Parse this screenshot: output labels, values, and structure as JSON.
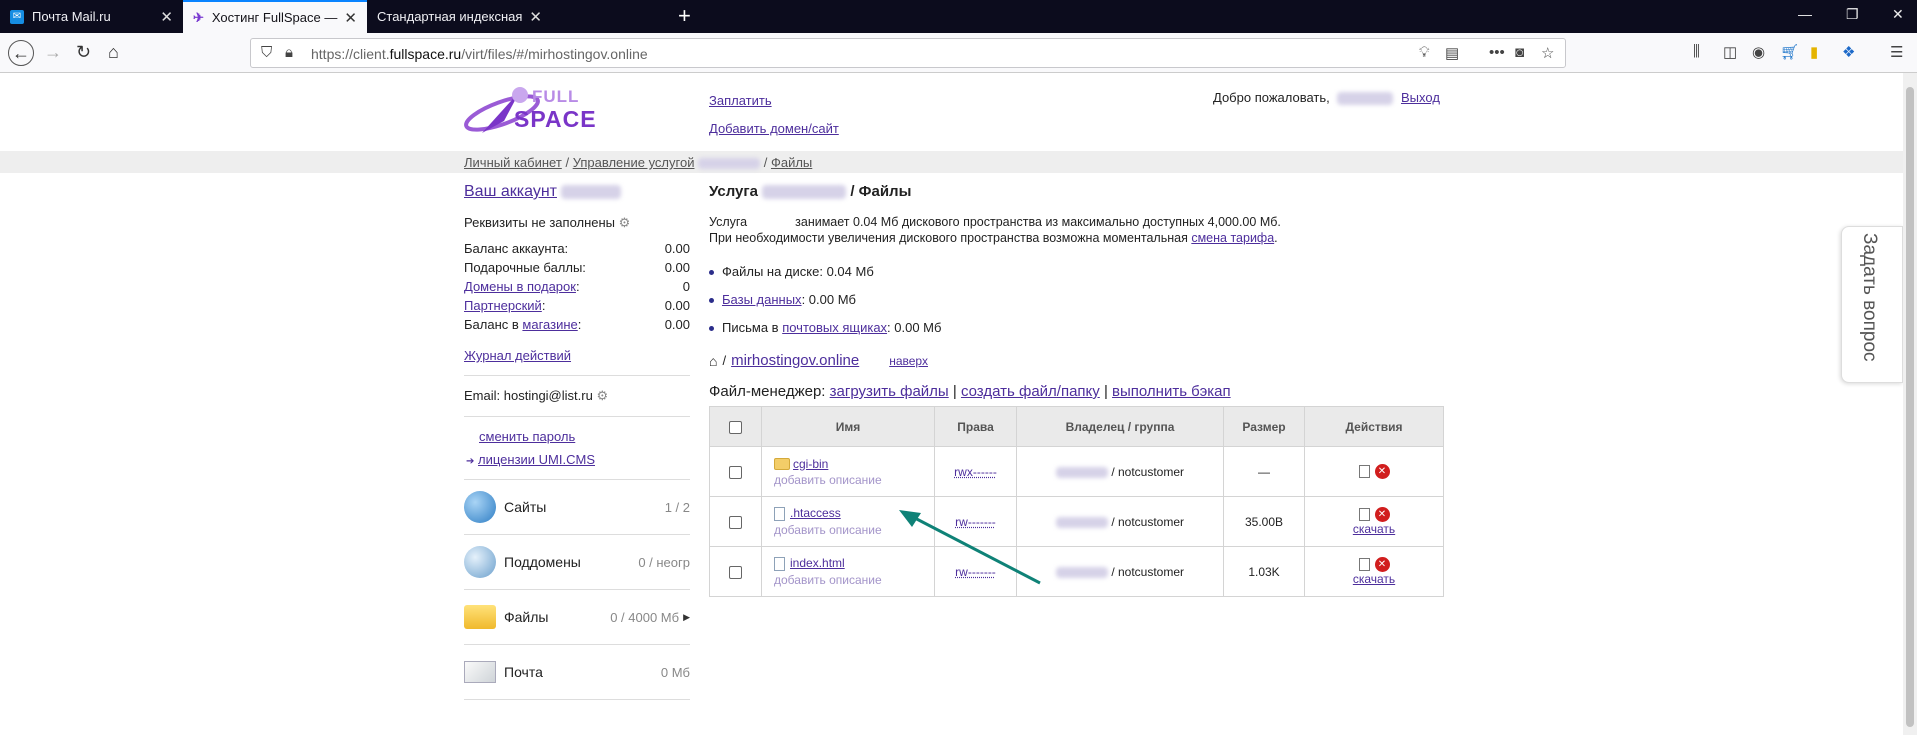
{
  "tabs": [
    {
      "title": "Почта Mail.ru",
      "icon": "mail-icon"
    },
    {
      "title": "Хостинг FullSpace — Личный",
      "icon": "fullspace-icon"
    },
    {
      "title": "Стандартная индексная страница",
      "icon": ""
    }
  ],
  "browser": {
    "url_prefix": "https://client.",
    "url_domain": "fullspace.ru",
    "url_path": "/virt/files/#/mirhostingov.online"
  },
  "logo": {
    "line1": "FULL",
    "line2": "SPACE"
  },
  "header": {
    "pay": "Заплатить",
    "add_domain": "Добавить домен/сайт",
    "welcome": "Добро пожаловать,",
    "logout": "Выход"
  },
  "breadcrumbs": {
    "cabinet": "Личный кабинет",
    "sep": "/",
    "services": "Управление услугой",
    "files": "Файлы"
  },
  "account": {
    "title": "Ваш аккаунт",
    "requisites": "Реквизиты не заполнены",
    "rows": [
      {
        "label": "Баланс аккаунта:",
        "value": "0.00"
      },
      {
        "label": "Подарочные баллы:",
        "value": "0.00"
      },
      {
        "label": "Домены в подарок",
        "suffix": ":",
        "value": "0"
      },
      {
        "label": "Партнерский",
        "suffix": ":",
        "value": "0.00"
      },
      {
        "label": "Баланс в",
        "link": "магазине",
        "suffix": ":",
        "value": "0.00"
      }
    ],
    "journal": "Журнал действий",
    "email_label": "Email:",
    "email": "hostingi@list.ru",
    "change_password": "сменить пароль",
    "umi": "лицензии UMI.CMS"
  },
  "services": [
    {
      "name": "Сайты",
      "count": "1 / 2",
      "icon": "globe-icon"
    },
    {
      "name": "Поддомены",
      "count": "0 / неогр",
      "icon": "subdomain-globe-icon"
    },
    {
      "name": "Файлы",
      "count": "0 / 4000 Мб",
      "icon": "folder-icon"
    },
    {
      "name": "Почта",
      "count": "0 Мб",
      "icon": "envelope-icon"
    }
  ],
  "main": {
    "title_prefix": "Услуга",
    "title_suffix": "/ Файлы",
    "usage_prefix": "Услуга",
    "usage_text": "занимает 0.04 Мб дискового пространства из максимально доступных 4,000.00 Мб.",
    "increase_text": "При необходимости увеличения дискового пространства возможна моментальная",
    "tariff_link": "смена тарифа",
    "period": ".",
    "stats": [
      {
        "pre": "Файлы на диске: 0.04 Мб",
        "link": "",
        "post": ""
      },
      {
        "pre": "",
        "link": "Базы данных",
        "post": ": 0.00 Мб"
      },
      {
        "pre": "Письма в ",
        "link": "почтовых ящиках",
        "post": ": 0.00 Мб"
      }
    ],
    "path_sep": "/",
    "path_domain": "mirhostingov.online",
    "up_link": "наверх",
    "fm_label": "Файл-менеджер:",
    "fm_upload": "загрузить файлы",
    "fm_sep": "|",
    "fm_create": "создать файл/папку",
    "fm_backup": "выполнить бэкап"
  },
  "table": {
    "headers": {
      "name": "Имя",
      "perms": "Права",
      "owner": "Владелец / группа",
      "size": "Размер",
      "actions": "Действия"
    },
    "rows": [
      {
        "name": "cgi-bin",
        "type": "folder",
        "desc": "добавить описание",
        "perms": "rwx------",
        "group": "/ notcustomer",
        "size": "—",
        "download": ""
      },
      {
        "name": ".htaccess",
        "type": "file",
        "desc": "добавить описание",
        "perms": "rw-------",
        "group": "/ notcustomer",
        "size": "35.00B",
        "download": "скачать"
      },
      {
        "name": "index.html",
        "type": "file",
        "desc": "добавить описание",
        "perms": "rw-------",
        "group": "/ notcustomer",
        "size": "1.03K",
        "download": "скачать"
      }
    ]
  },
  "ask_question": "Задать вопрос",
  "colors": {
    "link": "#4d2e9c",
    "arrow": "#0f8277",
    "tab_dark": "#0c0c1d"
  }
}
